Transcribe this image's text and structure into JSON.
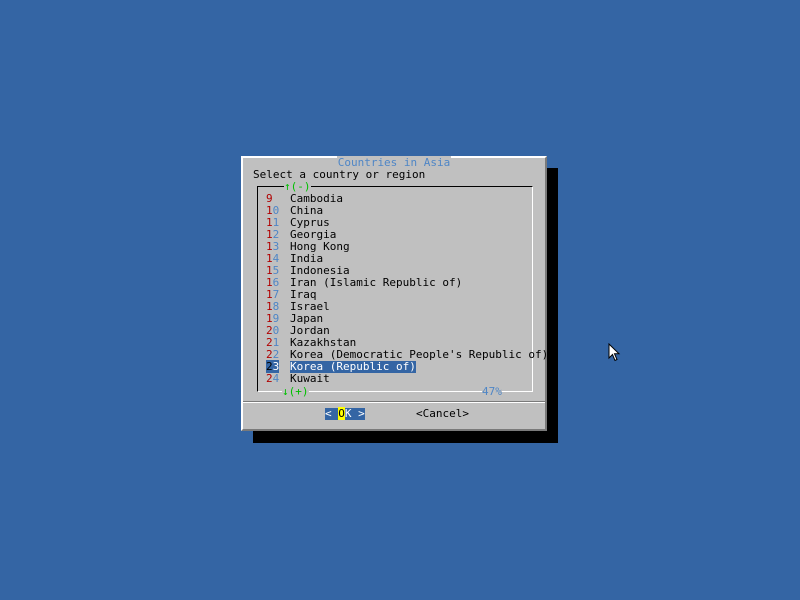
{
  "dialog": {
    "title": "Countries in Asia",
    "prompt": "Select a country or region",
    "scroll_up": "↑(-)",
    "scroll_down": "↓(+)",
    "percent": "47%",
    "items": [
      {
        "tag_first": "9",
        "tag_rest": "",
        "label": "Cambodia",
        "selected": false
      },
      {
        "tag_first": "1",
        "tag_rest": "0",
        "label": "China",
        "selected": false
      },
      {
        "tag_first": "1",
        "tag_rest": "1",
        "label": "Cyprus",
        "selected": false
      },
      {
        "tag_first": "1",
        "tag_rest": "2",
        "label": "Georgia",
        "selected": false
      },
      {
        "tag_first": "1",
        "tag_rest": "3",
        "label": "Hong Kong",
        "selected": false
      },
      {
        "tag_first": "1",
        "tag_rest": "4",
        "label": "India",
        "selected": false
      },
      {
        "tag_first": "1",
        "tag_rest": "5",
        "label": "Indonesia",
        "selected": false
      },
      {
        "tag_first": "1",
        "tag_rest": "6",
        "label": "Iran (Islamic Republic of)",
        "selected": false
      },
      {
        "tag_first": "1",
        "tag_rest": "7",
        "label": "Iraq",
        "selected": false
      },
      {
        "tag_first": "1",
        "tag_rest": "8",
        "label": "Israel",
        "selected": false
      },
      {
        "tag_first": "1",
        "tag_rest": "9",
        "label": "Japan",
        "selected": false
      },
      {
        "tag_first": "2",
        "tag_rest": "0",
        "label": "Jordan",
        "selected": false
      },
      {
        "tag_first": "2",
        "tag_rest": "1",
        "label": "Kazakhstan",
        "selected": false
      },
      {
        "tag_first": "2",
        "tag_rest": "2",
        "label": "Korea (Democratic People's Republic of)",
        "selected": false
      },
      {
        "tag_first": "2",
        "tag_rest": "3",
        "label": "Korea (Republic of)",
        "selected": true
      },
      {
        "tag_first": "2",
        "tag_rest": "4",
        "label": "Kuwait",
        "selected": false
      }
    ],
    "buttons": {
      "ok": {
        "left": "< ",
        "hot": "O",
        "rest": "K",
        "right": " >"
      },
      "cancel": "<Cancel>"
    }
  },
  "colors": {
    "desktop": "#3465a4",
    "dialog": "#c0c0c0",
    "title": "#4f86c6",
    "highlight": "#3465a4",
    "hotkey": "#ffff00",
    "scroll_indicator": "#00c000",
    "tag_digit": "#b00000"
  },
  "icons": {
    "pointer": "arrow-cursor-icon"
  }
}
